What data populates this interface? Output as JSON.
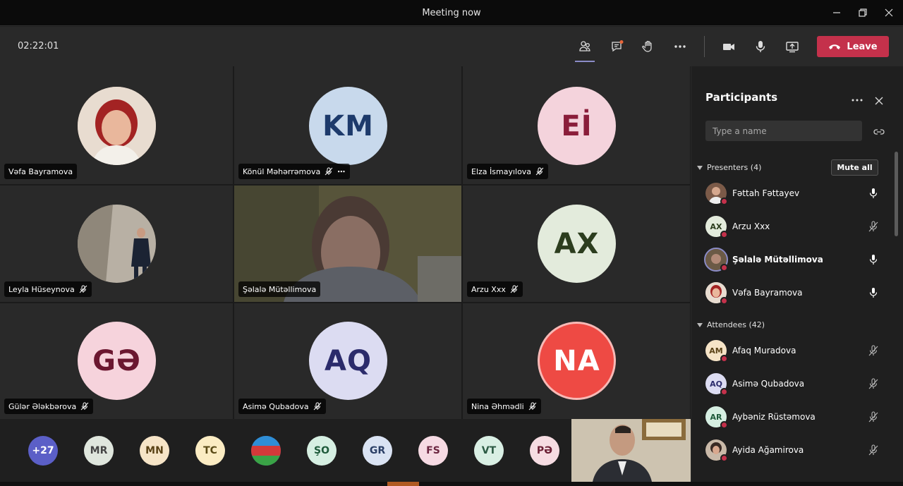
{
  "window": {
    "title": "Meeting now"
  },
  "toolbar": {
    "timer": "02:22:01",
    "leave_label": "Leave"
  },
  "tiles": [
    {
      "name": "Vəfa Bayramova",
      "initials": "",
      "muted": false,
      "photo": true
    },
    {
      "name": "Könül Məhərrəmova",
      "initials": "KM",
      "muted": true,
      "more": true
    },
    {
      "name": "Elza İsmayılova",
      "initials": "Eİ",
      "muted": true
    },
    {
      "name": "Leyla Hüseynova",
      "initials": "",
      "muted": true,
      "photo": true
    },
    {
      "name": "Şəlalə Mütəllimova",
      "initials": "",
      "muted": false,
      "video": true
    },
    {
      "name": "Arzu Xxx",
      "initials": "AX",
      "muted": true
    },
    {
      "name": "Gülər Ələkbərova",
      "initials": "GƏ",
      "muted": true
    },
    {
      "name": "Asimə Qubadova",
      "initials": "AQ",
      "muted": true
    },
    {
      "name": "Nina Əhmədli",
      "initials": "NA",
      "muted": true
    }
  ],
  "tray": [
    "+27",
    "MR",
    "MN",
    "TC",
    "",
    "ŞO",
    "GR",
    "FS",
    "VT",
    "PƏ"
  ],
  "panel": {
    "title": "Participants",
    "search_placeholder": "Type a name",
    "presenters_label": "Presenters (4)",
    "mute_all_label": "Mute all",
    "attendees_label": "Attendees (42)",
    "presenters": [
      {
        "name": "Fəttah Fəttayev",
        "initials": "",
        "muted": false
      },
      {
        "name": "Arzu Xxx",
        "initials": "AX",
        "muted": true
      },
      {
        "name": "Şəlalə Mütəllimova",
        "initials": "",
        "muted": false,
        "speaking": true
      },
      {
        "name": "Vəfa Bayramova",
        "initials": "",
        "muted": false
      }
    ],
    "attendees": [
      {
        "name": "Afaq Muradova",
        "initials": "AM",
        "muted": true
      },
      {
        "name": "Asimə Qubadova",
        "initials": "AQ",
        "muted": true
      },
      {
        "name": "Aybəniz Rüstəmova",
        "initials": "AR",
        "muted": true
      },
      {
        "name": "Ayida Ağamirova",
        "initials": "",
        "muted": true
      }
    ]
  },
  "colors": {
    "accent": "#8b8cc7",
    "leave": "#c4314b",
    "panel_bg": "#1f1f1f"
  }
}
